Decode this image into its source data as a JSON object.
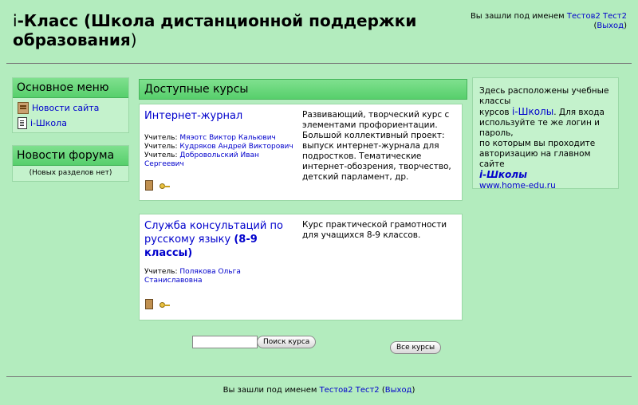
{
  "header": {
    "title_i": "i",
    "title_text": "-Класс (",
    "title_bold1": "Школа дистанционной поддержки",
    "title_bold2": "образования",
    "title_close": ")",
    "login_prefix": "Вы зашли под именем ",
    "user_name": "Тестов2 Тест2",
    "logout_open": "(",
    "logout": "Выход",
    "logout_close": ")"
  },
  "main_menu": {
    "title": "Основное меню",
    "items": [
      {
        "label": "Новости сайта",
        "icon": "news-icon"
      },
      {
        "label": "i-Школа",
        "icon": "document-icon"
      }
    ]
  },
  "forum_news": {
    "title": "Новости форума",
    "empty": "(Новых разделов нет)"
  },
  "courses": {
    "title": "Доступные курсы",
    "list": [
      {
        "name": "Интернет-журнал",
        "teacher_label": "Учитель: ",
        "teachers": [
          "Мяэотс Виктор Кальювич",
          "Кудряков Андрей Викторович",
          "Добровольский Иван Сергеевич"
        ],
        "summary": "Развивающий, творческий курс с элементами профориентации. Большой коллективный проект: выпуск интернет-журнала для подростков. Тематические интернет-обозрения, творчество, детский парламент, др."
      },
      {
        "name_plain": "Служба консультаций по русскому языку ",
        "name_bold": "(8-9 классы)",
        "teacher_label": "Учитель: ",
        "teachers": [
          "Полякова Ольга Станиславовна"
        ],
        "summary": "Курс практической грамотности для учащихся 8-9 классов."
      }
    ]
  },
  "info_block": {
    "line1": "Здесь расположены учебные классы",
    "line2_prefix": "курсов ",
    "line2_link": "i-Школы",
    "line2_suffix": ". Для входа используйте те же логин и пароль,",
    "line3": "по которым вы проходите авторизацию на главном сайте",
    "line4_link": "i-Школы",
    "line5_link": "www.home-edu.ru"
  },
  "search": {
    "input_value": "",
    "button": "Поиск курса",
    "all_courses": "Все курсы"
  },
  "footer": {
    "login_prefix": "Вы зашли под именем ",
    "user_name": "Тестов2 Тест2",
    "logout_open": " (",
    "logout": "Выход",
    "logout_close": ")"
  }
}
